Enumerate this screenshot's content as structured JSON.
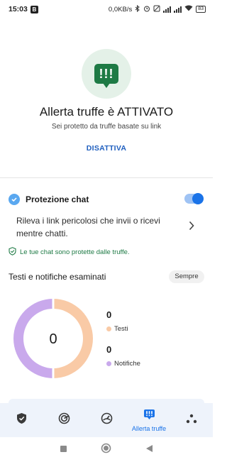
{
  "status_bar": {
    "time": "15:03",
    "b_badge": "B",
    "network_speed": "0,0KB/s",
    "battery": "83"
  },
  "hero": {
    "icon": "alert-chat-icon",
    "icon_glyph": "!!!",
    "title": "Allerta truffe è ATTIVATO",
    "subtitle": "Sei protetto da truffe basate su link",
    "disable_label": "DISATTIVA"
  },
  "chat_protection": {
    "title": "Protezione chat",
    "enabled": true,
    "description": "Rileva i link pericolosi che invii o ricevi mentre chatti.",
    "protected_note": "Le tue chat sono protette dalle truffe."
  },
  "scanned": {
    "title": "Testi e notifiche esaminati",
    "filter_chip": "Sempre",
    "total": "0",
    "items": [
      {
        "value": "0",
        "label": "Testi",
        "color": "#f9caa6"
      },
      {
        "value": "0",
        "label": "Notifiche",
        "color": "#c9a9ec"
      }
    ]
  },
  "bottom_nav": {
    "active_label": "Allerta truffe",
    "items": [
      {
        "icon": "shield-check-icon"
      },
      {
        "icon": "scan-icon"
      },
      {
        "icon": "speedometer-icon"
      },
      {
        "icon": "scam-alert-icon"
      },
      {
        "icon": "more-dots-icon"
      }
    ]
  },
  "colors": {
    "accent": "#1a73e8",
    "green": "#1e7a45",
    "orange": "#f9caa6",
    "purple": "#c9a9ec",
    "nav_bg": "#eef3fb"
  }
}
